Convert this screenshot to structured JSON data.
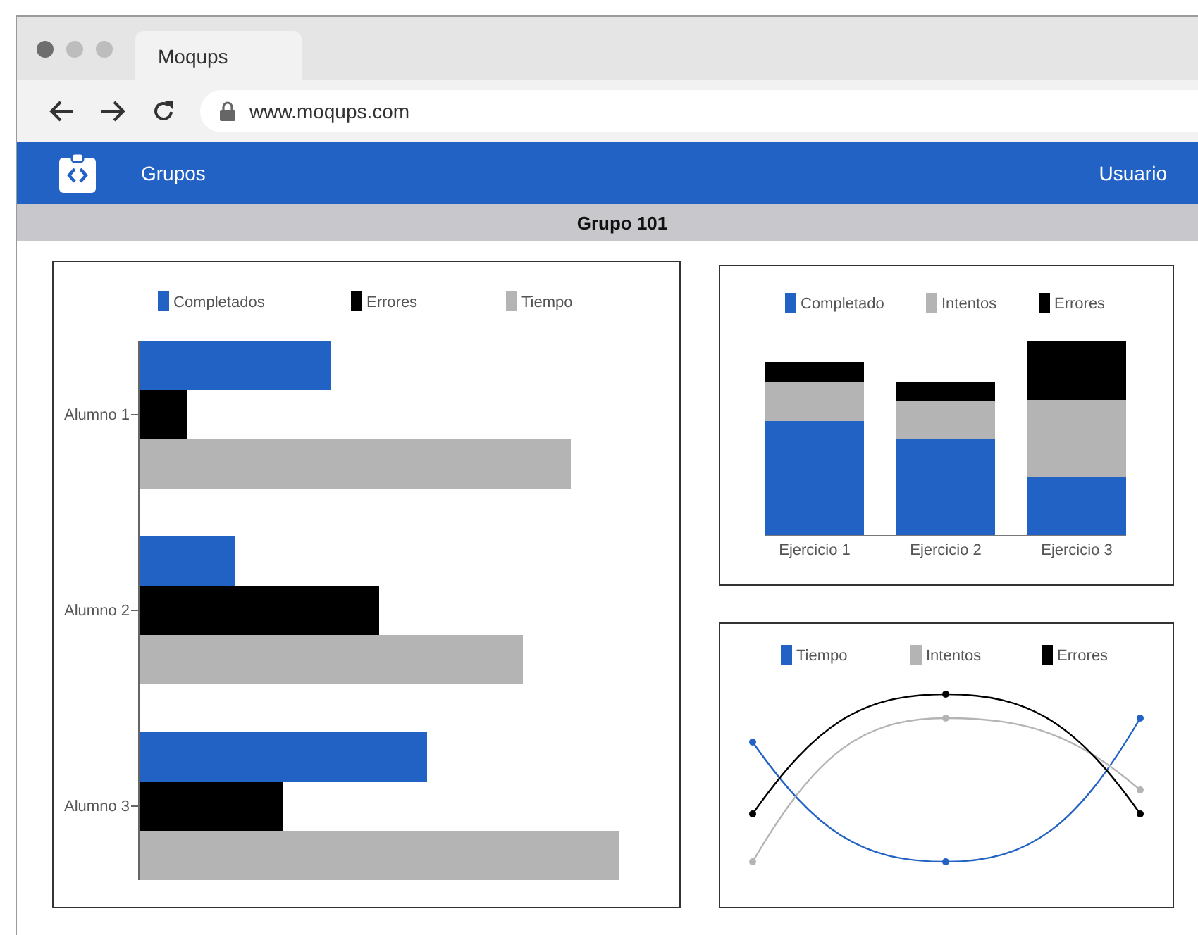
{
  "browser": {
    "tab_title": "Moqups",
    "url": "www.moqups.com"
  },
  "navbar": {
    "items": [
      {
        "label": "Grupos"
      }
    ],
    "user": "Usuario"
  },
  "group_bar": {
    "title": "Grupo 101"
  },
  "charts": [
    {
      "kind": "hbar",
      "legend": [
        {
          "name": "Completados",
          "color": "#2162c4"
        },
        {
          "name": "Errores",
          "color": "#000000"
        },
        {
          "name": "Tiempo",
          "color": "#b4b4b4"
        }
      ],
      "categories": [
        "Alumno 1",
        "Alumno 2",
        "Alumno 3"
      ]
    },
    {
      "kind": "stacked",
      "legend": [
        {
          "name": "Completado",
          "color": "#2162c4"
        },
        {
          "name": "Intentos",
          "color": "#b4b4b4"
        },
        {
          "name": "Errores",
          "color": "#000000"
        }
      ],
      "categories": [
        "Ejercicio 1",
        "Ejercicio 2",
        "Ejercicio 3"
      ]
    },
    {
      "kind": "line",
      "legend": [
        {
          "name": "Tiempo",
          "color": "#2162c4"
        },
        {
          "name": "Intentos",
          "color": "#b4b4b4"
        },
        {
          "name": "Errores",
          "color": "#000000"
        }
      ]
    }
  ]
}
